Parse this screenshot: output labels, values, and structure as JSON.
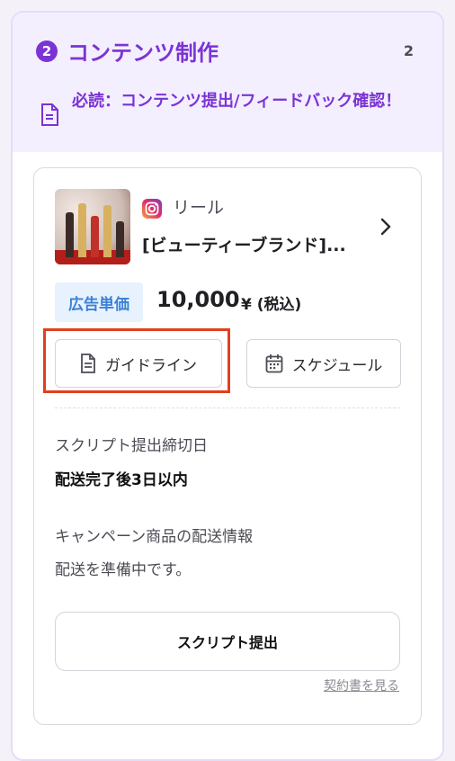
{
  "panel": {
    "step_number": "2",
    "title": "コンテンツ制作",
    "count": "2",
    "notice": "必読：コンテンツ提出/フィードバック確認！"
  },
  "card": {
    "platform_label": "リール",
    "product_title": "[ビューティーブランド]...",
    "price_tag": "広告単価",
    "price_value": "10,000",
    "price_unit": "¥ (税込)",
    "guide_button": "ガイドライン",
    "schedule_button": "スケジュール",
    "deadline_label": "スクリプト提出締切日",
    "deadline_value": "配送完了後3日以内",
    "shipping_label": "キャンペーン商品の配送情報",
    "shipping_value": "配送を準備中です。",
    "submit_button": "スクリプト提出",
    "contract_link": "契約書を見る"
  },
  "colors": {
    "accent": "#7c33d4",
    "price_blue": "#3b82d6",
    "highlight": "#e0401e"
  },
  "icons": [
    "document-icon",
    "instagram-icon",
    "chevron-right-icon",
    "calendar-icon"
  ]
}
